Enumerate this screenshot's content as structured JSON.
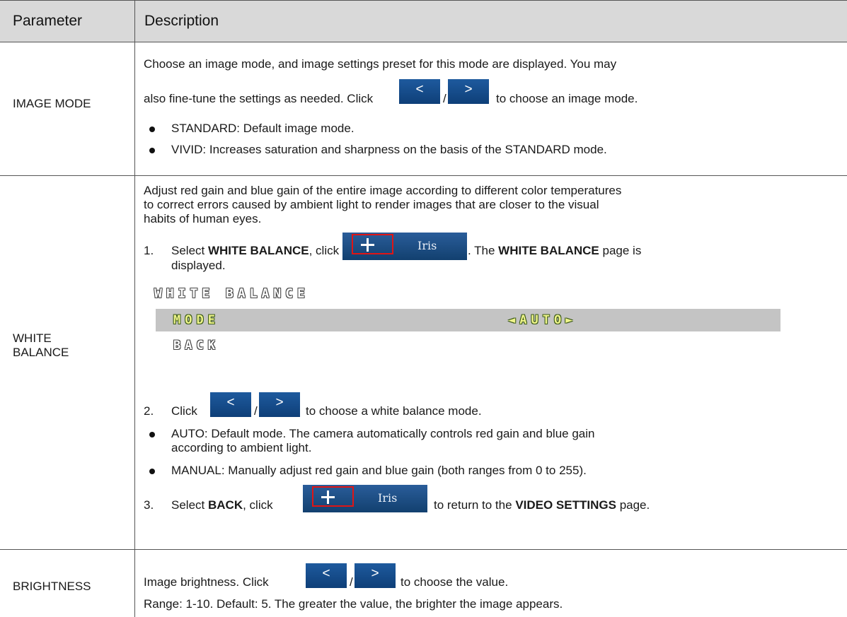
{
  "table": {
    "headers": {
      "parameter": "Parameter",
      "description": "Description"
    },
    "image_mode": {
      "name": "IMAGE MODE",
      "intro_line1": "Choose an image mode, and image settings preset for this mode are displayed. You may",
      "intro_line2_pre": "also fine-tune the settings as needed. Click",
      "slash": "/",
      "intro_line2_post": "to choose an image mode.",
      "bullet1": "STANDARD: Default image mode.",
      "bullet2": "VIVID: Increases saturation and sharpness on the basis of the STANDARD mode."
    },
    "white_balance": {
      "name_line1": "WHITE",
      "name_line2": "BALANCE",
      "intro_line1": "Adjust red gain and blue gain of the entire image according to different color temperatures",
      "intro_line2": "to correct errors caused by ambient light to render images that are closer to the visual",
      "intro_line3": "habits of human eyes.",
      "step1_num": "1.",
      "step1_pre": "Select",
      "step1_bold1": "WHITE BALANCE",
      "step1_mid": ", click",
      "step1_post": ". The",
      "step1_bold2": "WHITE BALANCE",
      "step1_end": "page is",
      "step1_line2": "displayed.",
      "step2_num": "2.",
      "step2_pre": "Click",
      "slash": "/",
      "step2_post": "to choose a white balance mode.",
      "bullet_auto_line1": "AUTO: Default mode. The camera automatically controls red gain and blue gain",
      "bullet_auto_line2": "according to ambient light.",
      "bullet_manual": "MANUAL: Manually adjust red gain and blue gain (both ranges from 0 to 255).",
      "step3_num": "3.",
      "step3_pre": "Select",
      "step3_bold1": "BACK",
      "step3_mid": ", click",
      "step3_post": "to return to the",
      "step3_bold2": "VIDEO SETTINGS",
      "step3_end": "page."
    },
    "osd_menu": {
      "title": "WHITE BALANCE",
      "mode_label": "MODE",
      "mode_value": "◄AUTO►",
      "back_label": "BACK"
    },
    "brightness": {
      "name": "BRIGHTNESS",
      "line1_pre": "Image brightness. Click",
      "slash": "/",
      "line1_post": "to choose the value.",
      "line2": "Range: 1-10. Default: 5. The greater the value, the brighter the image appears."
    }
  },
  "buttons": {
    "prev_label": "<",
    "next_label": ">",
    "plus_label": "+",
    "iris_label": "Iris"
  }
}
